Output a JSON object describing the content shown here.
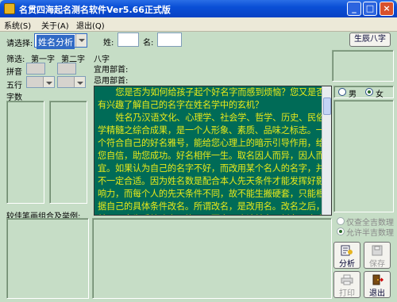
{
  "window": {
    "title": "名贯四海起名测名软件Ver5.66正式版",
    "min": "_",
    "max": "□",
    "close": "×"
  },
  "menu": [
    "系统(S)",
    "关于(A)",
    "退出(Q)"
  ],
  "select": {
    "label": "请选择:",
    "value": "姓名分析"
  },
  "name": {
    "surname_label": "姓:",
    "given_label": "名:"
  },
  "btn_shengchen": "生辰八字",
  "bazi": {
    "bazi_label": "八字",
    "yi_label": "宜用部首:",
    "ji_label": "忌用部首:"
  },
  "filter": {
    "label": "筛选:",
    "col1": "第一字",
    "col2": "第二字",
    "pinyin": "拼音",
    "wuxing": "五行",
    "zishu": "字数"
  },
  "gender": {
    "male": "男",
    "female": "女",
    "selected": "female"
  },
  "article": [
    "您是否为如何给孩子起个好名字而感到烦恼？您又是否有兴趣了解自己的名字在姓名学中的玄机？",
    "姓名乃汉语文化、心理学、社会学、哲学、历史、民俗学精髓之综合成果，是一个人形象、素质、品味之标志。一个符合自己的好名雅号，能给您心理上的暗示引导作用，给您自信，助您成功。好名相伴一生。取名因人而异，因人而宜。如果认为自己的名字不好，而改用某个名人的名字，并不一定合适。因为姓名数是配合本人先天条件才能发挥好影响力，而每个人的先天条件不同，故不能生搬硬套，只能根据自己的具体条件改名。所谓改名，是改用名。改名之后，并不一定为手续改户口簿，只要自己确认并多用新名，也会有好的影响和作用。"
  ],
  "combo_label": "较佳笔画组合及举例:",
  "options": {
    "opt1": "仅查全吉数理",
    "opt2": "允许半吉数理",
    "selected": "opt2"
  },
  "buttons": {
    "analyze": "分析",
    "save": "保存",
    "print": "打印",
    "exit": "退出"
  },
  "colors": {
    "article_bg": "#006b57",
    "article_text": "#e9e91a",
    "window_bg": "#c6ddc6",
    "title_blue": "#0a4fd6"
  }
}
